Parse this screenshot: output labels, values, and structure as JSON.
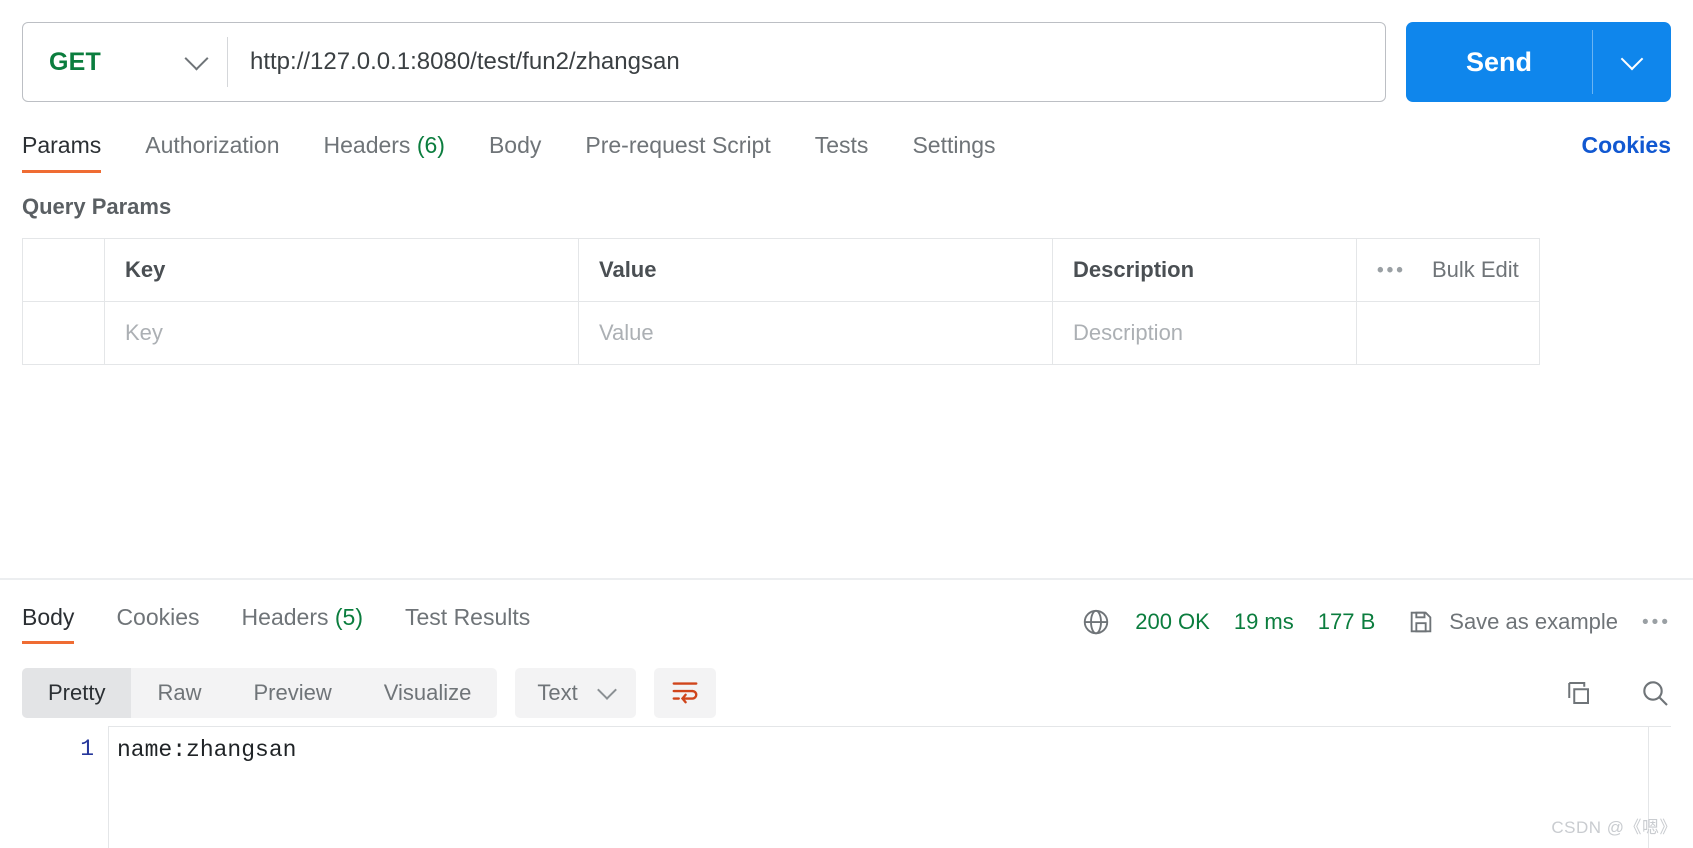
{
  "request": {
    "method": "GET",
    "url": "http://127.0.0.1:8080/test/fun2/zhangsan",
    "send_label": "Send",
    "tabs": [
      {
        "label": "Params",
        "count": ""
      },
      {
        "label": "Authorization",
        "count": ""
      },
      {
        "label": "Headers",
        "count": "(6)"
      },
      {
        "label": "Body",
        "count": ""
      },
      {
        "label": "Pre-request Script",
        "count": ""
      },
      {
        "label": "Tests",
        "count": ""
      },
      {
        "label": "Settings",
        "count": ""
      }
    ],
    "cookies_link": "Cookies"
  },
  "query_params": {
    "title": "Query Params",
    "headers": {
      "key": "Key",
      "value": "Value",
      "description": "Description",
      "bulk_edit": "Bulk Edit",
      "more_icon": "•••"
    },
    "rows": [
      {
        "key_placeholder": "Key",
        "value_placeholder": "Value",
        "description_placeholder": "Description"
      }
    ]
  },
  "response": {
    "tabs": [
      {
        "label": "Body",
        "count": ""
      },
      {
        "label": "Cookies",
        "count": ""
      },
      {
        "label": "Headers",
        "count": "(5)"
      },
      {
        "label": "Test Results",
        "count": ""
      }
    ],
    "status": "200 OK",
    "time": "19 ms",
    "size": "177 B",
    "save_as_example": "Save as example",
    "more_icon": "•••",
    "toolbar": {
      "view_modes": [
        "Pretty",
        "Raw",
        "Preview",
        "Visualize"
      ],
      "active_view": "Pretty",
      "format": "Text"
    },
    "body": {
      "lines": [
        {
          "number": "1",
          "text": "name:zhangsan"
        }
      ]
    }
  },
  "watermark": "CSDN @《嗯》",
  "colors": {
    "accent_orange": "#ef6c33",
    "send_blue": "#0f86ec",
    "link_blue": "#1158d1",
    "status_green": "#0b7d3e",
    "method_green": "#0b7d3e"
  }
}
